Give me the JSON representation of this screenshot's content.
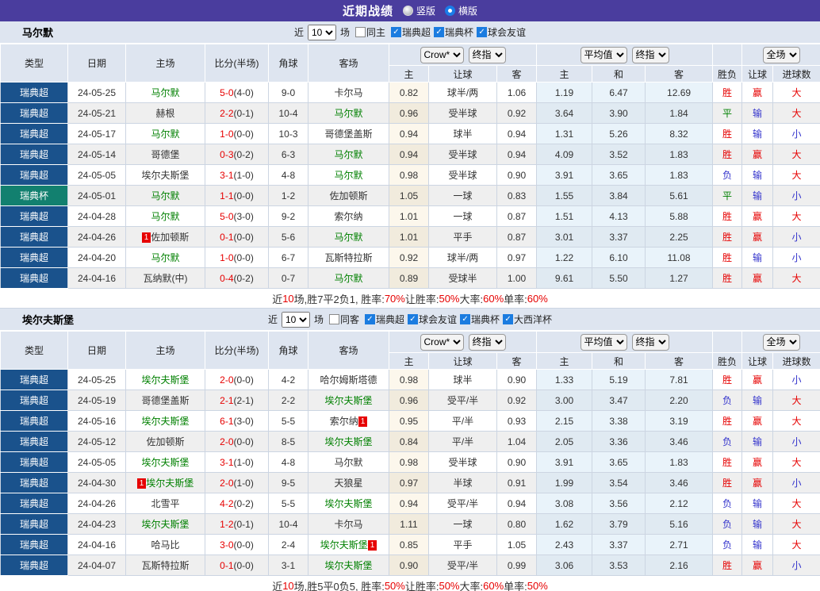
{
  "title_bar": {
    "title": "近期战绩",
    "radios": [
      {
        "label": "竖版",
        "checked": false
      },
      {
        "label": "横版",
        "checked": true
      }
    ]
  },
  "colors": {
    "titlebar_purple": "#4a3d9e",
    "header_bg": "#dee5f0",
    "league_navy": "#1a528c",
    "cup_teal": "#12806f",
    "win_red": "#e60000",
    "draw_green": "#008000",
    "lose_blue": "#3333cc",
    "self_team_green": "#008000",
    "avg_col_bg": "#e9f3fa",
    "odds_col_bg": "#fcf7ec",
    "check_blue": "#1b7ce0",
    "radio_blue": "#1a7ce8",
    "row_alt_bg": "#efefef",
    "grid_border": "#ccd5e2"
  },
  "table_columns": [
    "类型",
    "日期",
    "主场",
    "比分(半场)",
    "角球",
    "客场",
    "主",
    "让球",
    "客",
    "主",
    "和",
    "客",
    "胜负",
    "让球",
    "进球数"
  ],
  "selects": {
    "company": "Crow*",
    "final1": "终指",
    "avg": "平均值",
    "final2": "终指",
    "scope": "全场"
  },
  "filter_labels": {
    "near": "近",
    "games": "场"
  },
  "sections": [
    {
      "team": "马尔默",
      "filter": {
        "games_value": "10",
        "same_label": "同主",
        "same_checked": false,
        "leagues": [
          {
            "label": "瑞典超",
            "checked": true
          },
          {
            "label": "瑞典杯",
            "checked": true
          },
          {
            "label": "球会友谊",
            "checked": true
          }
        ]
      },
      "rows": [
        {
          "type": "瑞典超",
          "cup": false,
          "date": "24-05-25",
          "home": "马尔默",
          "home_self": true,
          "home_rc": null,
          "score": "5-0",
          "half": "(4-0)",
          "corner": "9-0",
          "away": "卡尔马",
          "away_self": false,
          "away_rc": null,
          "odds": [
            "0.82",
            "球半/两",
            "1.06"
          ],
          "avg": [
            "1.19",
            "6.47",
            "12.69"
          ],
          "results": [
            [
              "胜",
              "r"
            ],
            [
              "赢",
              "r"
            ],
            [
              "大",
              "r"
            ]
          ]
        },
        {
          "type": "瑞典超",
          "cup": false,
          "date": "24-05-21",
          "home": "赫根",
          "home_self": false,
          "home_rc": null,
          "score": "2-2",
          "half": "(0-1)",
          "corner": "10-4",
          "away": "马尔默",
          "away_self": true,
          "away_rc": null,
          "odds": [
            "0.96",
            "受半球",
            "0.92"
          ],
          "avg": [
            "3.64",
            "3.90",
            "1.84"
          ],
          "results": [
            [
              "平",
              "g"
            ],
            [
              "输",
              "b"
            ],
            [
              "大",
              "r"
            ]
          ]
        },
        {
          "type": "瑞典超",
          "cup": false,
          "date": "24-05-17",
          "home": "马尔默",
          "home_self": true,
          "home_rc": null,
          "score": "1-0",
          "half": "(0-0)",
          "corner": "10-3",
          "away": "哥德堡盖斯",
          "away_self": false,
          "away_rc": null,
          "odds": [
            "0.94",
            "球半",
            "0.94"
          ],
          "avg": [
            "1.31",
            "5.26",
            "8.32"
          ],
          "results": [
            [
              "胜",
              "r"
            ],
            [
              "输",
              "b"
            ],
            [
              "小",
              "b"
            ]
          ]
        },
        {
          "type": "瑞典超",
          "cup": false,
          "date": "24-05-14",
          "home": "哥德堡",
          "home_self": false,
          "home_rc": null,
          "score": "0-3",
          "half": "(0-2)",
          "corner": "6-3",
          "away": "马尔默",
          "away_self": true,
          "away_rc": null,
          "odds": [
            "0.94",
            "受半球",
            "0.94"
          ],
          "avg": [
            "4.09",
            "3.52",
            "1.83"
          ],
          "results": [
            [
              "胜",
              "r"
            ],
            [
              "赢",
              "r"
            ],
            [
              "大",
              "r"
            ]
          ]
        },
        {
          "type": "瑞典超",
          "cup": false,
          "date": "24-05-05",
          "home": "埃尔夫斯堡",
          "home_self": false,
          "home_rc": null,
          "score": "3-1",
          "half": "(1-0)",
          "corner": "4-8",
          "away": "马尔默",
          "away_self": true,
          "away_rc": null,
          "odds": [
            "0.98",
            "受半球",
            "0.90"
          ],
          "avg": [
            "3.91",
            "3.65",
            "1.83"
          ],
          "results": [
            [
              "负",
              "b"
            ],
            [
              "输",
              "b"
            ],
            [
              "大",
              "r"
            ]
          ]
        },
        {
          "type": "瑞典杯",
          "cup": true,
          "date": "24-05-01",
          "home": "马尔默",
          "home_self": true,
          "home_rc": null,
          "score": "1-1",
          "half": "(0-0)",
          "corner": "1-2",
          "away": "佐加顿斯",
          "away_self": false,
          "away_rc": null,
          "odds": [
            "1.05",
            "一球",
            "0.83"
          ],
          "avg": [
            "1.55",
            "3.84",
            "5.61"
          ],
          "results": [
            [
              "平",
              "g"
            ],
            [
              "输",
              "b"
            ],
            [
              "小",
              "b"
            ]
          ]
        },
        {
          "type": "瑞典超",
          "cup": false,
          "date": "24-04-28",
          "home": "马尔默",
          "home_self": true,
          "home_rc": null,
          "score": "5-0",
          "half": "(3-0)",
          "corner": "9-2",
          "away": "索尔纳",
          "away_self": false,
          "away_rc": null,
          "odds": [
            "1.01",
            "一球",
            "0.87"
          ],
          "avg": [
            "1.51",
            "4.13",
            "5.88"
          ],
          "results": [
            [
              "胜",
              "r"
            ],
            [
              "赢",
              "r"
            ],
            [
              "大",
              "r"
            ]
          ]
        },
        {
          "type": "瑞典超",
          "cup": false,
          "date": "24-04-26",
          "home": "佐加顿斯",
          "home_self": false,
          "home_rc": "before",
          "score": "0-1",
          "half": "(0-0)",
          "corner": "5-6",
          "away": "马尔默",
          "away_self": true,
          "away_rc": null,
          "odds": [
            "1.01",
            "平手",
            "0.87"
          ],
          "avg": [
            "3.01",
            "3.37",
            "2.25"
          ],
          "results": [
            [
              "胜",
              "r"
            ],
            [
              "赢",
              "r"
            ],
            [
              "小",
              "b"
            ]
          ]
        },
        {
          "type": "瑞典超",
          "cup": false,
          "date": "24-04-20",
          "home": "马尔默",
          "home_self": true,
          "home_rc": null,
          "score": "1-0",
          "half": "(0-0)",
          "corner": "6-7",
          "away": "瓦斯特拉斯",
          "away_self": false,
          "away_rc": null,
          "odds": [
            "0.92",
            "球半/两",
            "0.97"
          ],
          "avg": [
            "1.22",
            "6.10",
            "11.08"
          ],
          "results": [
            [
              "胜",
              "r"
            ],
            [
              "输",
              "b"
            ],
            [
              "小",
              "b"
            ]
          ]
        },
        {
          "type": "瑞典超",
          "cup": false,
          "date": "24-04-16",
          "home": "瓦纳默(中)",
          "home_self": false,
          "home_rc": null,
          "score": "0-4",
          "half": "(0-2)",
          "corner": "0-7",
          "away": "马尔默",
          "away_self": true,
          "away_rc": null,
          "odds": [
            "0.89",
            "受球半",
            "1.00"
          ],
          "avg": [
            "9.61",
            "5.50",
            "1.27"
          ],
          "results": [
            [
              "胜",
              "r"
            ],
            [
              "赢",
              "r"
            ],
            [
              "大",
              "r"
            ]
          ]
        }
      ],
      "summary": [
        [
          "近",
          false
        ],
        [
          "10",
          true
        ],
        [
          "场,胜7平2负1, 胜率:",
          false
        ],
        [
          "70%",
          true
        ],
        [
          " 让胜率:",
          false
        ],
        [
          "50%",
          true
        ],
        [
          " 大率:",
          false
        ],
        [
          "60%",
          true
        ],
        [
          " 单率:",
          false
        ],
        [
          "60%",
          true
        ]
      ]
    },
    {
      "team": "埃尔夫斯堡",
      "filter": {
        "games_value": "10",
        "same_label": "同客",
        "same_checked": false,
        "leagues": [
          {
            "label": "瑞典超",
            "checked": true
          },
          {
            "label": "球会友谊",
            "checked": true
          },
          {
            "label": "瑞典杯",
            "checked": true
          },
          {
            "label": "大西洋杯",
            "checked": true
          }
        ]
      },
      "rows": [
        {
          "type": "瑞典超",
          "cup": false,
          "date": "24-05-25",
          "home": "埃尔夫斯堡",
          "home_self": true,
          "home_rc": null,
          "score": "2-0",
          "half": "(0-0)",
          "corner": "4-2",
          "away": "哈尔姆斯塔德",
          "away_self": false,
          "away_rc": null,
          "odds": [
            "0.98",
            "球半",
            "0.90"
          ],
          "avg": [
            "1.33",
            "5.19",
            "7.81"
          ],
          "results": [
            [
              "胜",
              "r"
            ],
            [
              "赢",
              "r"
            ],
            [
              "小",
              "b"
            ]
          ]
        },
        {
          "type": "瑞典超",
          "cup": false,
          "date": "24-05-19",
          "home": "哥德堡盖斯",
          "home_self": false,
          "home_rc": null,
          "score": "2-1",
          "half": "(2-1)",
          "corner": "2-2",
          "away": "埃尔夫斯堡",
          "away_self": true,
          "away_rc": null,
          "odds": [
            "0.96",
            "受平/半",
            "0.92"
          ],
          "avg": [
            "3.00",
            "3.47",
            "2.20"
          ],
          "results": [
            [
              "负",
              "b"
            ],
            [
              "输",
              "b"
            ],
            [
              "大",
              "r"
            ]
          ]
        },
        {
          "type": "瑞典超",
          "cup": false,
          "date": "24-05-16",
          "home": "埃尔夫斯堡",
          "home_self": true,
          "home_rc": null,
          "score": "6-1",
          "half": "(3-0)",
          "corner": "5-5",
          "away": "索尔纳",
          "away_self": false,
          "away_rc": "after",
          "odds": [
            "0.95",
            "平/半",
            "0.93"
          ],
          "avg": [
            "2.15",
            "3.38",
            "3.19"
          ],
          "results": [
            [
              "胜",
              "r"
            ],
            [
              "赢",
              "r"
            ],
            [
              "大",
              "r"
            ]
          ]
        },
        {
          "type": "瑞典超",
          "cup": false,
          "date": "24-05-12",
          "home": "佐加顿斯",
          "home_self": false,
          "home_rc": null,
          "score": "2-0",
          "half": "(0-0)",
          "corner": "8-5",
          "away": "埃尔夫斯堡",
          "away_self": true,
          "away_rc": null,
          "odds": [
            "0.84",
            "平/半",
            "1.04"
          ],
          "avg": [
            "2.05",
            "3.36",
            "3.46"
          ],
          "results": [
            [
              "负",
              "b"
            ],
            [
              "输",
              "b"
            ],
            [
              "小",
              "b"
            ]
          ]
        },
        {
          "type": "瑞典超",
          "cup": false,
          "date": "24-05-05",
          "home": "埃尔夫斯堡",
          "home_self": true,
          "home_rc": null,
          "score": "3-1",
          "half": "(1-0)",
          "corner": "4-8",
          "away": "马尔默",
          "away_self": false,
          "away_rc": null,
          "odds": [
            "0.98",
            "受半球",
            "0.90"
          ],
          "avg": [
            "3.91",
            "3.65",
            "1.83"
          ],
          "results": [
            [
              "胜",
              "r"
            ],
            [
              "赢",
              "r"
            ],
            [
              "大",
              "r"
            ]
          ]
        },
        {
          "type": "瑞典超",
          "cup": false,
          "date": "24-04-30",
          "home": "埃尔夫斯堡",
          "home_self": true,
          "home_rc": "before",
          "score": "2-0",
          "half": "(1-0)",
          "corner": "9-5",
          "away": "天狼星",
          "away_self": false,
          "away_rc": null,
          "odds": [
            "0.97",
            "半球",
            "0.91"
          ],
          "avg": [
            "1.99",
            "3.54",
            "3.46"
          ],
          "results": [
            [
              "胜",
              "r"
            ],
            [
              "赢",
              "r"
            ],
            [
              "小",
              "b"
            ]
          ]
        },
        {
          "type": "瑞典超",
          "cup": false,
          "date": "24-04-26",
          "home": "北雪平",
          "home_self": false,
          "home_rc": null,
          "score": "4-2",
          "half": "(0-2)",
          "corner": "5-5",
          "away": "埃尔夫斯堡",
          "away_self": true,
          "away_rc": null,
          "odds": [
            "0.94",
            "受平/半",
            "0.94"
          ],
          "avg": [
            "3.08",
            "3.56",
            "2.12"
          ],
          "results": [
            [
              "负",
              "b"
            ],
            [
              "输",
              "b"
            ],
            [
              "大",
              "r"
            ]
          ]
        },
        {
          "type": "瑞典超",
          "cup": false,
          "date": "24-04-23",
          "home": "埃尔夫斯堡",
          "home_self": true,
          "home_rc": null,
          "score": "1-2",
          "half": "(0-1)",
          "corner": "10-4",
          "away": "卡尔马",
          "away_self": false,
          "away_rc": null,
          "odds": [
            "1.11",
            "一球",
            "0.80"
          ],
          "avg": [
            "1.62",
            "3.79",
            "5.16"
          ],
          "results": [
            [
              "负",
              "b"
            ],
            [
              "输",
              "b"
            ],
            [
              "大",
              "r"
            ]
          ]
        },
        {
          "type": "瑞典超",
          "cup": false,
          "date": "24-04-16",
          "home": "哈马比",
          "home_self": false,
          "home_rc": null,
          "score": "3-0",
          "half": "(0-0)",
          "corner": "2-4",
          "away": "埃尔夫斯堡",
          "away_self": true,
          "away_rc": "after",
          "odds": [
            "0.85",
            "平手",
            "1.05"
          ],
          "avg": [
            "2.43",
            "3.37",
            "2.71"
          ],
          "results": [
            [
              "负",
              "b"
            ],
            [
              "输",
              "b"
            ],
            [
              "大",
              "r"
            ]
          ]
        },
        {
          "type": "瑞典超",
          "cup": false,
          "date": "24-04-07",
          "home": "瓦斯特拉斯",
          "home_self": false,
          "home_rc": null,
          "score": "0-1",
          "half": "(0-0)",
          "corner": "3-1",
          "away": "埃尔夫斯堡",
          "away_self": true,
          "away_rc": null,
          "odds": [
            "0.90",
            "受平/半",
            "0.99"
          ],
          "avg": [
            "3.06",
            "3.53",
            "2.16"
          ],
          "results": [
            [
              "胜",
              "r"
            ],
            [
              "赢",
              "r"
            ],
            [
              "小",
              "b"
            ]
          ]
        }
      ],
      "summary": [
        [
          "近",
          false
        ],
        [
          "10",
          true
        ],
        [
          "场,胜5平0负5, 胜率:",
          false
        ],
        [
          "50%",
          true
        ],
        [
          " 让胜率:",
          false
        ],
        [
          "50%",
          true
        ],
        [
          " 大率:",
          false
        ],
        [
          "60%",
          true
        ],
        [
          " 单率:",
          false
        ],
        [
          "50%",
          true
        ]
      ]
    }
  ]
}
